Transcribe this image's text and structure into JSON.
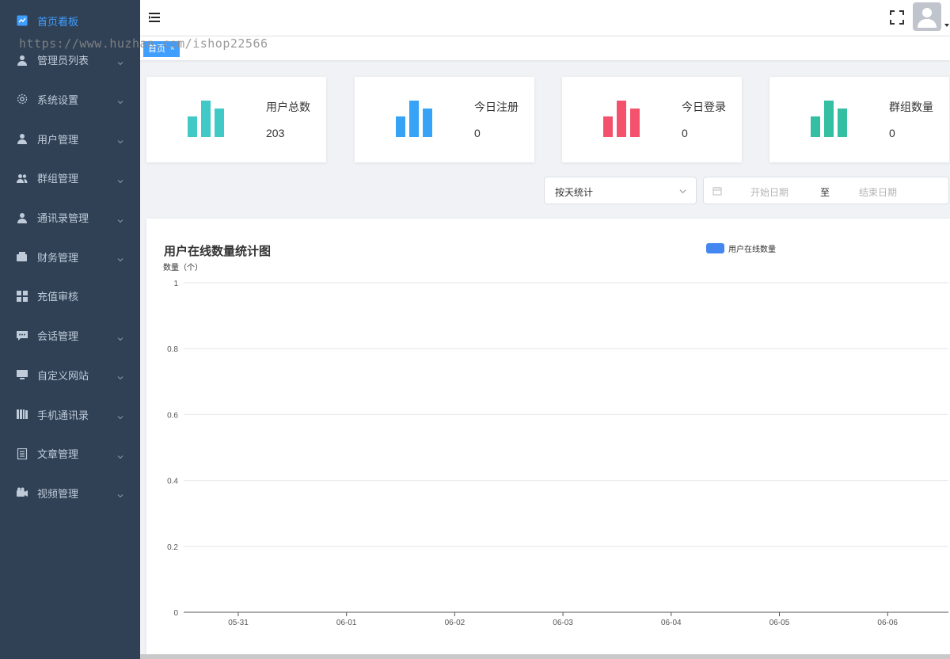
{
  "sidebar": {
    "items": [
      {
        "label": "首页看板",
        "icon": "dashboard-icon",
        "active": true,
        "arrow": false
      },
      {
        "label": "管理员列表",
        "icon": "user-icon",
        "active": false,
        "arrow": true
      },
      {
        "label": "系统设置",
        "icon": "gear-icon",
        "active": false,
        "arrow": true
      },
      {
        "label": "用户管理",
        "icon": "user-icon",
        "active": false,
        "arrow": true
      },
      {
        "label": "群组管理",
        "icon": "group-icon",
        "active": false,
        "arrow": true
      },
      {
        "label": "通讯录管理",
        "icon": "user-icon",
        "active": false,
        "arrow": true
      },
      {
        "label": "财务管理",
        "icon": "wallet-icon",
        "active": false,
        "arrow": true
      },
      {
        "label": "充值审核",
        "icon": "grid-icon",
        "active": false,
        "arrow": false
      },
      {
        "label": "会话管理",
        "icon": "chat-icon",
        "active": false,
        "arrow": true
      },
      {
        "label": "自定义网站",
        "icon": "monitor-icon",
        "active": false,
        "arrow": true
      },
      {
        "label": "手机通讯录",
        "icon": "book-icon",
        "active": false,
        "arrow": true
      },
      {
        "label": "文章管理",
        "icon": "document-icon",
        "active": false,
        "arrow": true
      },
      {
        "label": "视频管理",
        "icon": "video-icon",
        "active": false,
        "arrow": true
      }
    ],
    "colors": {
      "bg": "#304156",
      "text": "#bfcbd9",
      "active": "#409eff"
    }
  },
  "tags": [
    {
      "label": "首页",
      "close": "×"
    }
  ],
  "watermark": "https://www.huzhan.com/ishop22566",
  "stats": [
    {
      "label": "用户总数",
      "value": "203",
      "color": "#40c9c6"
    },
    {
      "label": "今日注册",
      "value": "0",
      "color": "#36a3f7"
    },
    {
      "label": "今日登录",
      "value": "0",
      "color": "#f4516c"
    },
    {
      "label": "群组数量",
      "value": "0",
      "color": "#34bfa3"
    }
  ],
  "filters": {
    "select_value": "按天统计",
    "start_placeholder": "开始日期",
    "separator": "至",
    "end_placeholder": "结束日期"
  },
  "chart_data": {
    "type": "bar",
    "title": "用户在线数量统计图",
    "ylabel": "数量（个）",
    "xlabel": "",
    "categories": [
      "05-31",
      "06-01",
      "06-02",
      "06-03",
      "06-04",
      "06-05",
      "06-06"
    ],
    "series": [
      {
        "name": "用户在线数量",
        "values": [
          0,
          0,
          0,
          0,
          0,
          0,
          0
        ],
        "color": "#4587f0"
      }
    ],
    "ylim": [
      0,
      1
    ],
    "yticks": [
      "1",
      "0.8",
      "0.6",
      "0.4",
      "0.2",
      "0"
    ],
    "grid": true,
    "legend": "top-right"
  }
}
